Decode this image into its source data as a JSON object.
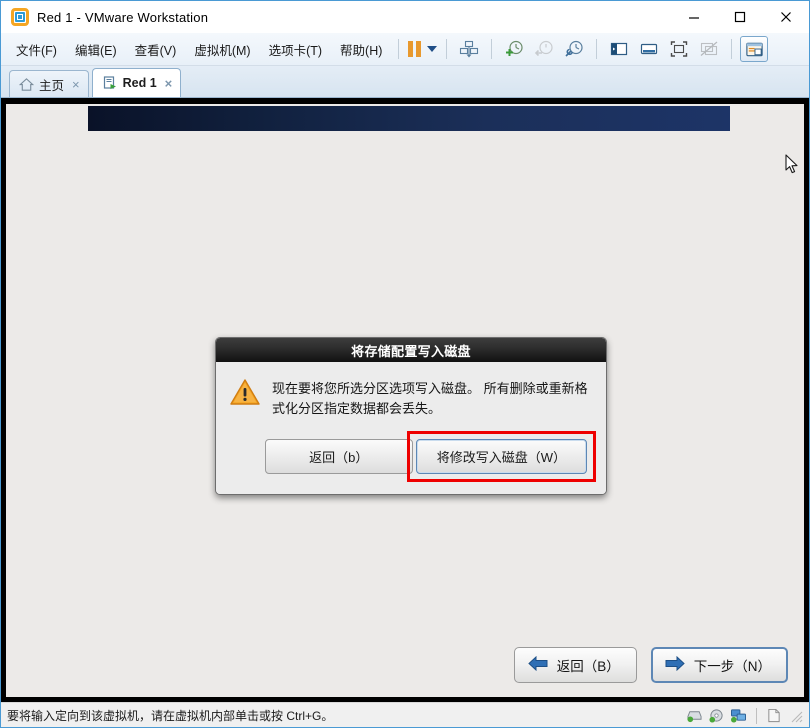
{
  "window": {
    "title": "Red 1 - VMware Workstation",
    "app_icon": "vmware-logo-icon",
    "controls": {
      "minimize": "minimize-icon",
      "maximize": "maximize-icon",
      "close": "close-icon"
    }
  },
  "menu": {
    "items": [
      {
        "label": "文件(F)"
      },
      {
        "label": "编辑(E)"
      },
      {
        "label": "查看(V)"
      },
      {
        "label": "虚拟机(M)"
      },
      {
        "label": "选项卡(T)"
      },
      {
        "label": "帮助(H)"
      }
    ],
    "pause_button": "pause-icon",
    "pause_dropdown": "chevron-down-icon",
    "tools": [
      {
        "name": "send-ctrl-alt-delete-icon",
        "enabled": true
      },
      {
        "name": "take-snapshot-icon",
        "enabled": true
      },
      {
        "name": "revert-snapshot-icon",
        "enabled": false
      },
      {
        "name": "manage-snapshots-icon",
        "enabled": true
      },
      {
        "name": "show-library-icon",
        "enabled": true
      },
      {
        "name": "show-thumbnail-bar-icon",
        "enabled": true
      },
      {
        "name": "enter-fullscreen-icon",
        "enabled": true
      },
      {
        "name": "unity-mode-icon",
        "enabled": false
      },
      {
        "name": "console-view-icon",
        "enabled": true
      }
    ]
  },
  "tabs": [
    {
      "label": "主页",
      "icon": "home-icon",
      "active": false,
      "close": "×"
    },
    {
      "label": "Red 1",
      "icon": "virtual-machine-icon",
      "active": true,
      "close": "×"
    }
  ],
  "vm_screen": {
    "banner_color": "#16294d",
    "background_color": "#eceae8"
  },
  "dialog": {
    "title": "将存储配置写入磁盘",
    "warning_icon": "warning-triangle-icon",
    "message": "现在要将您所选分区选项写入磁盘。 所有删除或重新格式化分区指定数据都会丢失。",
    "back_button": "返回（b）",
    "write_button": "将修改写入磁盘（W）",
    "highlight_color": "#ee0000"
  },
  "installer_nav": {
    "back_button": "返回（B）",
    "back_icon": "arrow-left-icon",
    "next_button": "下一步（N）",
    "next_icon": "arrow-right-icon"
  },
  "status_bar": {
    "message": "要将输入定向到该虚拟机，请在虚拟机内部单击或按 Ctrl+G。",
    "devices": [
      {
        "name": "hard-disk-icon"
      },
      {
        "name": "cd-dvd-drive-icon"
      },
      {
        "name": "network-adapter-icon"
      },
      {
        "name": "usb-device-icon"
      }
    ],
    "resize_grip": "resize-grip-icon"
  }
}
